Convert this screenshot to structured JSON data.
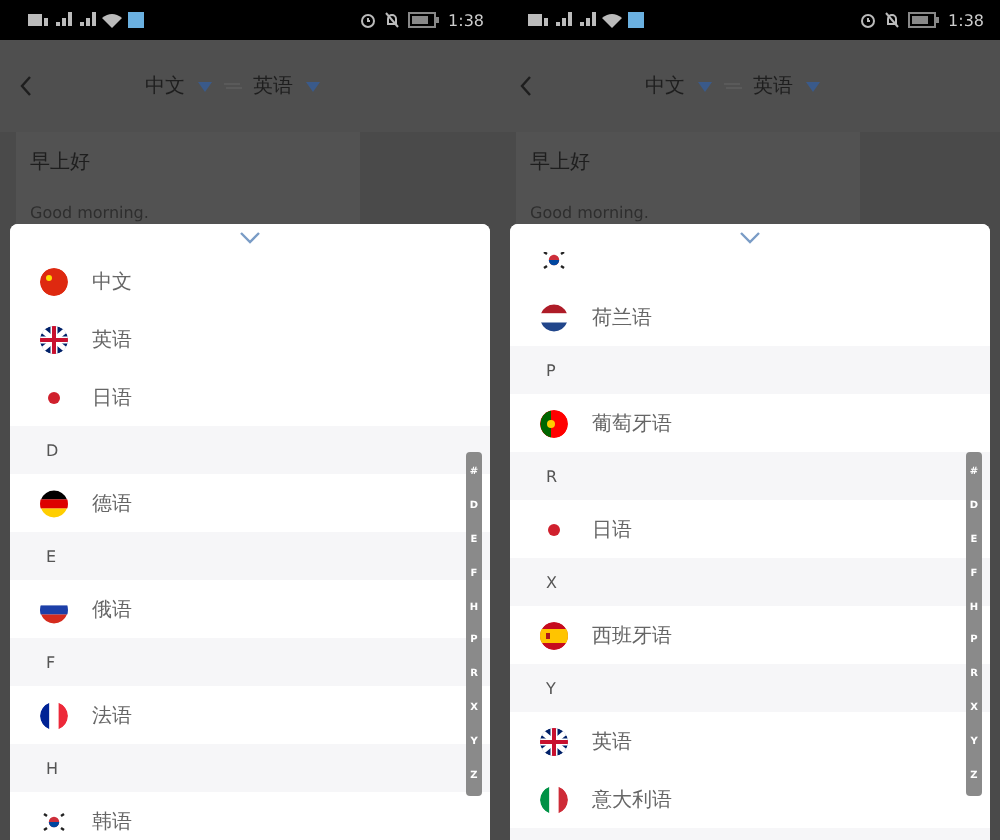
{
  "phones": [
    {
      "status_bar": {
        "time": "1:38"
      },
      "nav": {
        "source": "中文",
        "target": "英语"
      },
      "card": {
        "text": "早上好",
        "translation": "Good morning."
      },
      "list_scrolled": false,
      "index": [
        "#",
        "D",
        "E",
        "F",
        "H",
        "P",
        "R",
        "X",
        "Y",
        "Z"
      ],
      "items": [
        {
          "kind": "language",
          "flag": {
            "kind": "cn"
          },
          "label": "中文"
        },
        {
          "kind": "language",
          "flag": {
            "kind": "gb"
          },
          "label": "英语"
        },
        {
          "kind": "language",
          "flag": {
            "kind": "jp"
          },
          "label": "日语"
        },
        {
          "kind": "header",
          "label": "D"
        },
        {
          "kind": "language",
          "flag": {
            "kind": "de"
          },
          "label": "德语"
        },
        {
          "kind": "header",
          "label": "E"
        },
        {
          "kind": "language",
          "flag": {
            "kind": "ru"
          },
          "label": "俄语"
        },
        {
          "kind": "header",
          "label": "F"
        },
        {
          "kind": "language",
          "flag": {
            "kind": "fr"
          },
          "label": "法语"
        },
        {
          "kind": "header",
          "label": "H"
        },
        {
          "kind": "language",
          "flag": {
            "kind": "kr"
          },
          "label": "韩语"
        }
      ]
    },
    {
      "status_bar": {
        "time": "1:38"
      },
      "nav": {
        "source": "中文",
        "target": "英语"
      },
      "card": {
        "text": "早上好",
        "translation": "Good morning."
      },
      "list_scrolled": true,
      "index": [
        "#",
        "D",
        "E",
        "F",
        "H",
        "P",
        "R",
        "X",
        "Y",
        "Z"
      ],
      "items": [
        {
          "kind": "language",
          "flag": {
            "kind": "kr"
          }
        },
        {
          "kind": "language",
          "flag": {
            "kind": "nl"
          },
          "label": "荷兰语"
        },
        {
          "kind": "header",
          "label": "P"
        },
        {
          "kind": "language",
          "flag": {
            "kind": "pt"
          },
          "label": "葡萄牙语"
        },
        {
          "kind": "header",
          "label": "R"
        },
        {
          "kind": "language",
          "flag": {
            "kind": "jp"
          },
          "label": "日语"
        },
        {
          "kind": "header",
          "label": "X"
        },
        {
          "kind": "language",
          "flag": {
            "kind": "es"
          },
          "label": "西班牙语"
        },
        {
          "kind": "header",
          "label": "Y"
        },
        {
          "kind": "language",
          "flag": {
            "kind": "gb"
          },
          "label": "英语"
        },
        {
          "kind": "language",
          "flag": {
            "kind": "it"
          },
          "label": "意大利语"
        },
        {
          "kind": "header"
        }
      ]
    }
  ]
}
